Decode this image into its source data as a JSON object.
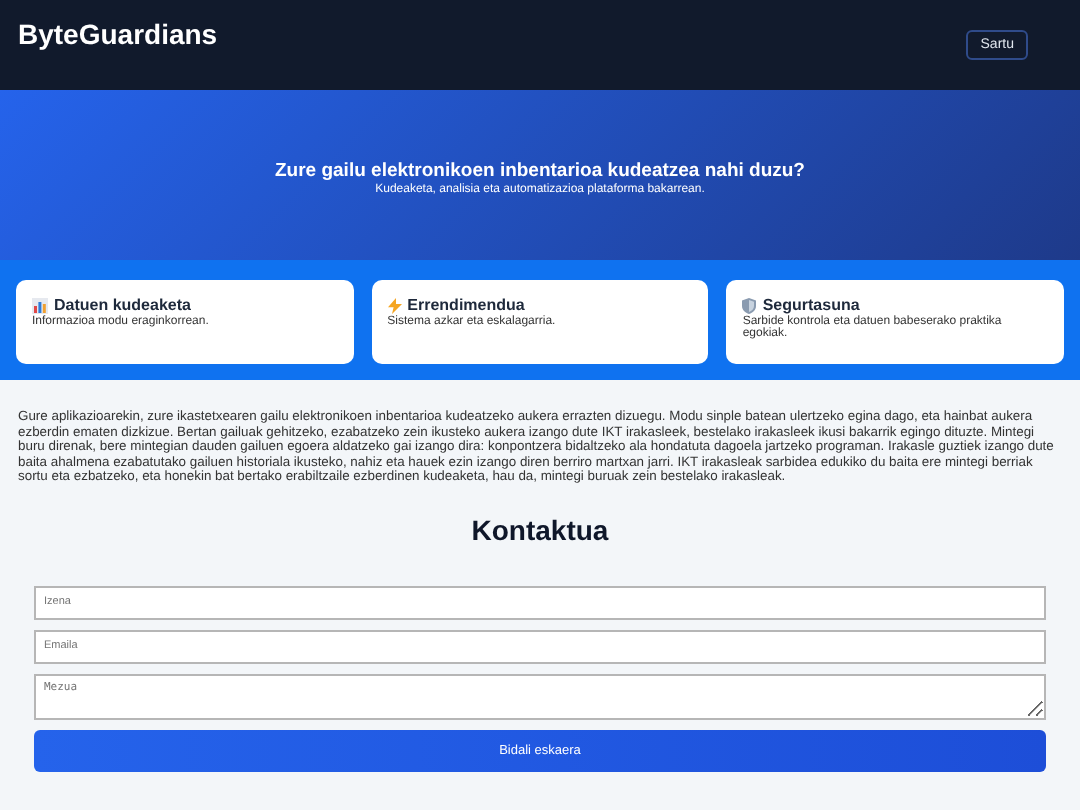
{
  "header": {
    "logo": "ByteGuardians",
    "login_button": "Sartu"
  },
  "hero": {
    "title": "Zure gailu elektronikoen inbentarioa kudeatzea nahi duzu?",
    "subtitle": "Kudeaketa, analisia eta automatizazioa plataforma bakarrean."
  },
  "features": [
    {
      "kind": "chart",
      "title": "Datuen kudeaketa",
      "text": "Informazioa modu eraginkorrean."
    },
    {
      "kind": "bolt",
      "title": "Errendimendua",
      "text": "Sistema azkar eta eskalagarria."
    },
    {
      "kind": "shield",
      "title": "Segurtasuna",
      "text": "Sarbide kontrola eta datuen babeserako praktika egokiak."
    }
  ],
  "description": "Gure aplikazioarekin, zure ikastetxearen gailu elektronikoen inbentarioa kudeatzeko aukera errazten dizuegu. Modu sinple batean ulertzeko egina dago, eta hainbat aukera ezberdin ematen dizkizue. Bertan gailuak gehitzeko, ezabatzeko zein ikusteko aukera izango dute IKT irakasleek, bestelako irakasleek ikusi bakarrik egingo dituzte. Mintegi buru direnak, bere mintegian dauden gailuen egoera aldatzeko gai izango dira: konpontzera bidaltzeko ala hondatuta dagoela jartzeko programan. Irakasle guztiek izango dute baita ahalmena ezabatutako gailuen historiala ikusteko, nahiz eta hauek ezin izango diren berriro martxan jarri. IKT irakasleak sarbidea edukiko du baita ere mintegi berriak sortu eta ezbatzeko, eta honekin bat bertako erabiltzaile ezberdinen kudeaketa, hau da, mintegi buruak zein bestelako irakasleak.",
  "contact": {
    "title": "Kontaktua",
    "fields": [
      {
        "kind": "input",
        "placeholder": "Izena"
      },
      {
        "kind": "input",
        "placeholder": "Emaila"
      },
      {
        "kind": "textarea",
        "placeholder": "Mezua"
      }
    ],
    "submit_button": "Bidali eskaera"
  }
}
